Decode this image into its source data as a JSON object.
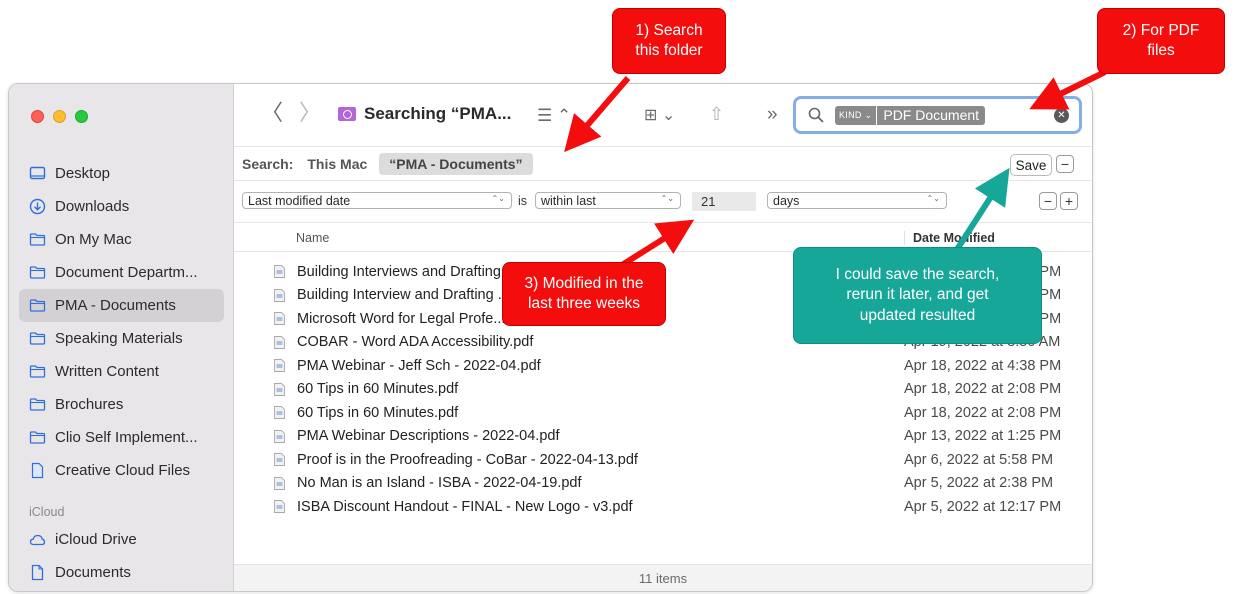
{
  "window": {
    "title": "Searching “PMA...",
    "search": {
      "kind_label": "KIND ⌄",
      "kind_value": "PDF Document",
      "clear": "✕"
    },
    "toolbar": {
      "back": "〈",
      "forward": "〉",
      "view_list": "☰ ⌃",
      "view_group": "⊞ ⌄",
      "share": "⇧",
      "more": "»"
    }
  },
  "sidebar": {
    "items": [
      {
        "label": "Desktop",
        "icon": "desktop-icon"
      },
      {
        "label": "Downloads",
        "icon": "download-icon"
      },
      {
        "label": "On My Mac",
        "icon": "folder-icon"
      },
      {
        "label": "Document Departm...",
        "icon": "folder-icon"
      },
      {
        "label": "PMA - Documents",
        "icon": "folder-icon",
        "selected": true
      },
      {
        "label": "Speaking Materials",
        "icon": "folder-icon"
      },
      {
        "label": "Written Content",
        "icon": "folder-icon"
      },
      {
        "label": "Brochures",
        "icon": "folder-icon"
      },
      {
        "label": "Clio Self Implement...",
        "icon": "folder-icon"
      },
      {
        "label": "Creative Cloud Files",
        "icon": "file-icon"
      }
    ],
    "section": "iCloud",
    "icloud_items": [
      {
        "label": "iCloud Drive",
        "icon": "cloud-icon"
      },
      {
        "label": "Documents",
        "icon": "document-icon"
      }
    ]
  },
  "scope": {
    "label": "Search:",
    "this_mac": "This Mac",
    "selected": "“PMA - Documents”",
    "save": "Save",
    "minus": "−",
    "plus": "+"
  },
  "criteria": {
    "attribute": "Last modified date",
    "is": "is",
    "operator": "within last",
    "value": "21",
    "unit": "days"
  },
  "columns": {
    "name": "Name",
    "date": "Date Modified"
  },
  "files": [
    {
      "name": "Building Interviews and Drafting ... - 2022-04-21.pdf",
      "date": "Apr 21, 2022 at 2:49 PM"
    },
    {
      "name": "Building Interview and Drafting ...",
      "date": "Apr 21, 2022 at 2:46 PM"
    },
    {
      "name": "Microsoft Word for Legal Profe...",
      "date": "Apr 20, 2022 at 3:13 PM"
    },
    {
      "name": "COBAR - Word ADA Accessibility.pdf",
      "date": "Apr 19, 2022 at 8:50 AM"
    },
    {
      "name": "PMA Webinar - Jeff Sch - 2022-04.pdf",
      "date": "Apr 18, 2022 at 4:38 PM"
    },
    {
      "name": "60 Tips in 60 Minutes.pdf",
      "date": "Apr 18, 2022 at 2:08 PM"
    },
    {
      "name": "60 Tips in 60 Minutes.pdf",
      "date": "Apr 18, 2022 at 2:08 PM"
    },
    {
      "name": "PMA Webinar Descriptions - 2022-04.pdf",
      "date": "Apr 13, 2022 at 1:25 PM"
    },
    {
      "name": "Proof is in the Proofreading - CoBar - 2022-04-13.pdf",
      "date": "Apr 6, 2022 at 5:58 PM"
    },
    {
      "name": "No Man is an Island - ISBA - 2022-04-19.pdf",
      "date": "Apr 5, 2022 at 2:38 PM"
    },
    {
      "name": "ISBA Discount Handout - FINAL - New Logo - v3.pdf",
      "date": "Apr 5, 2022 at 12:17 PM"
    }
  ],
  "status": "11 items",
  "callouts": {
    "c1": "1) Search\nthis folder",
    "c2": "2) For PDF\nfiles",
    "c3": "3) Modified in the\nlast three weeks",
    "c4": "I could save the search,\nrerun it later, and get\nupdated resulted"
  },
  "colors": {
    "callout_red": "#f40d0d",
    "callout_teal": "#16a798",
    "search_focus": "#83aee6"
  }
}
